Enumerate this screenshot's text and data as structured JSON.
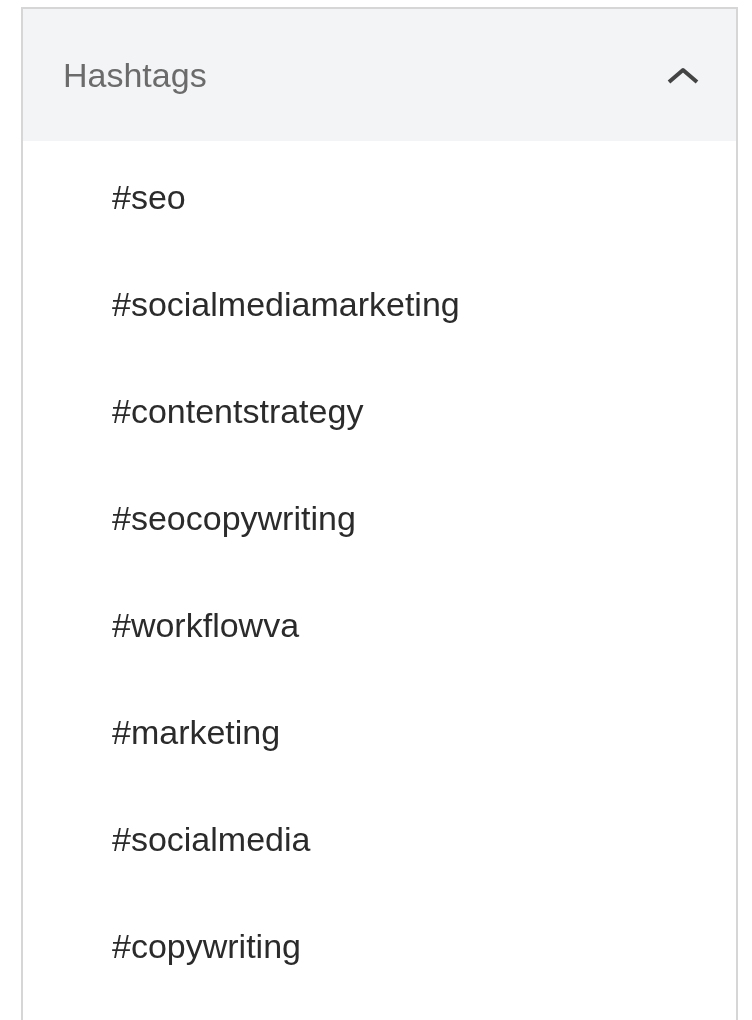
{
  "section": {
    "title": "Hashtags",
    "expanded": true,
    "items": [
      {
        "label": "#seo"
      },
      {
        "label": "#socialmediamarketing"
      },
      {
        "label": "#contentstrategy"
      },
      {
        "label": "#seocopywriting"
      },
      {
        "label": "#workflowva"
      },
      {
        "label": "#marketing"
      },
      {
        "label": "#socialmedia"
      },
      {
        "label": "#copywriting"
      }
    ]
  }
}
